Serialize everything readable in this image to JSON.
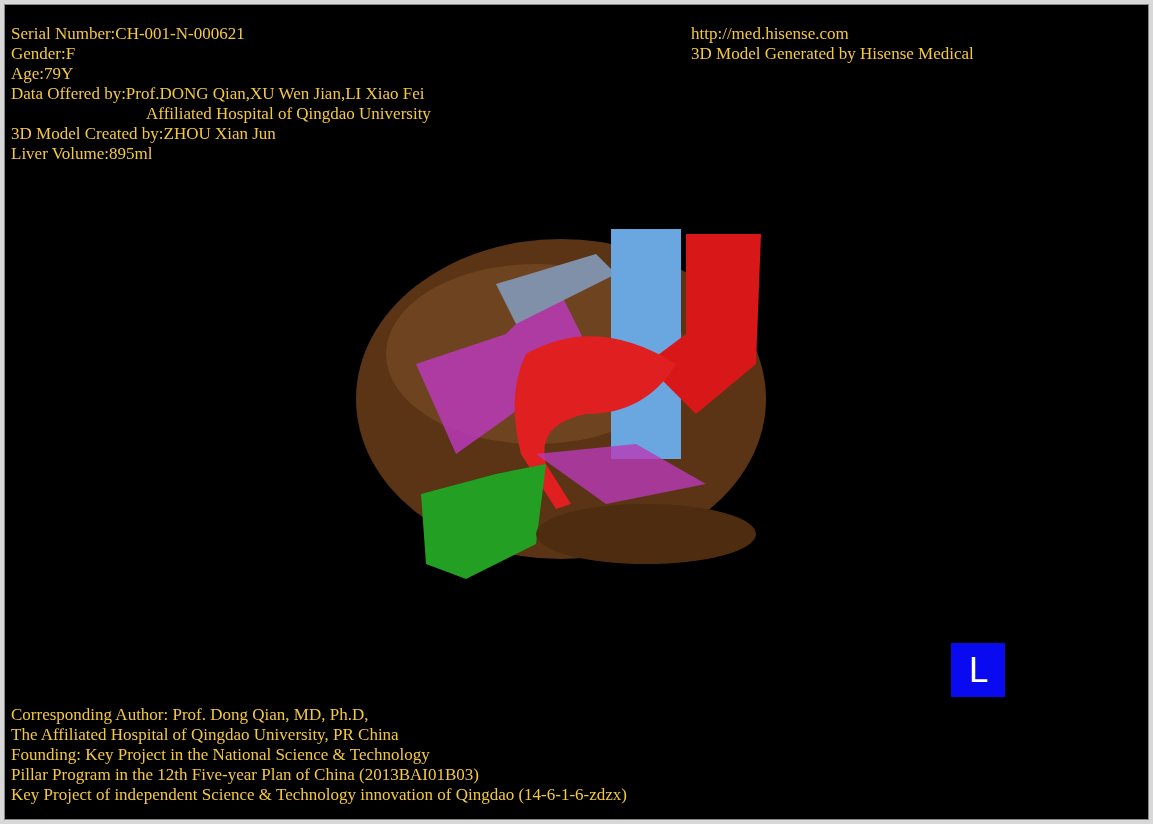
{
  "patient_info": [
    {
      "text": "Serial Number:CH-001-N-000621",
      "indented": false
    },
    {
      "text": "Gender:F",
      "indented": false
    },
    {
      "text": "Age:79Y",
      "indented": false
    },
    {
      "text": "Data Offered by:Prof.DONG Qian,XU Wen Jian,LI Xiao Fei",
      "indented": false
    },
    {
      "text": "Affiliated Hospital of Qingdao University",
      "indented": true
    },
    {
      "text": "3D Model Created by:ZHOU Xian Jun",
      "indented": false
    },
    {
      "text": "Liver Volume:895ml",
      "indented": false
    }
  ],
  "site_info": [
    "http://med.hisense.com",
    "3D Model Generated by Hisense Medical"
  ],
  "orientation_badge": "L",
  "credits": [
    "Corresponding Author: Prof. Dong Qian, MD, Ph.D,",
    "The Affiliated Hospital of Qingdao University, PR China",
    "Founding: Key Project in the National Science & Technology",
    "Pillar Program in the 12th Five-year Plan of China (2013BAI01B03)",
    "Key Project of independent Science & Technology innovation of Qingdao (14-6-1-6-zdzx)"
  ]
}
